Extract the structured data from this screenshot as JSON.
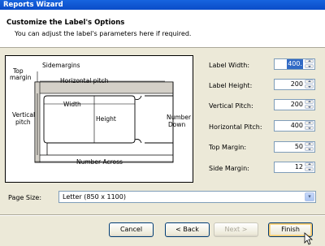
{
  "window": {
    "title": "Reports Wizard"
  },
  "header": {
    "title": "Customize the Label's Options",
    "subtitle": "You can adjust the label's parameters here if required."
  },
  "diagram": {
    "labels": {
      "top_margin": "Top",
      "top_margin2": "margin",
      "side_margins": "Sidemargins",
      "horizontal_pitch": "Horizontal pitch",
      "width": "Width",
      "height": "Height",
      "vertical": "Vertical",
      "pitch": "pitch",
      "number": "Number",
      "down": "Down",
      "number_across": "Number Across"
    }
  },
  "fields": [
    {
      "label": "Label Width:",
      "value": "400."
    },
    {
      "label": "Label Height:",
      "value": "200"
    },
    {
      "label": "Vertical Pitch:",
      "value": "200"
    },
    {
      "label": "Horizontal Pitch:",
      "value": "400"
    },
    {
      "label": "Top Margin:",
      "value": "50"
    },
    {
      "label": "Side Margin:",
      "value": "12"
    }
  ],
  "page_size": {
    "label": "Page Size:",
    "value": "Letter (850 x 1100)"
  },
  "buttons": {
    "cancel": "Cancel",
    "back": "< Back",
    "next": "Next >",
    "finish": "Finish"
  },
  "colors": {
    "titlebar": "#0a4cc8",
    "selection": "#316ac5",
    "dialog": "#ece9d8"
  }
}
